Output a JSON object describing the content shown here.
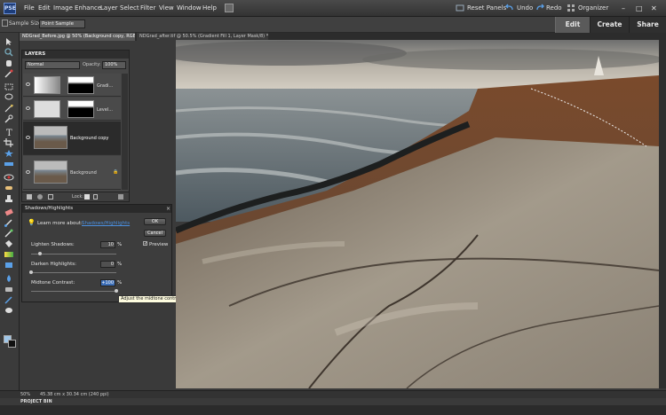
{
  "app": {
    "logo_text": "PSE",
    "menu": [
      "File",
      "Edit",
      "Image",
      "Enhance",
      "Layer",
      "Select",
      "Filter",
      "View",
      "Window",
      "Help"
    ],
    "reset_panels": "Reset Panels",
    "undo": "Undo",
    "redo": "Redo",
    "organizer": "Organizer"
  },
  "modes": {
    "edit": "Edit",
    "create": "Create",
    "share": "Share",
    "active": "Edit"
  },
  "options_bar": {
    "sample_size_label": "Sample Size:",
    "sample_size_value": "Point Sample"
  },
  "doc_tabs": [
    {
      "label": "NDGrad_Before.jpg @ 50% (Background copy, RGB/8*) *"
    },
    {
      "label": "NDGrad_after.tif @ 50.5% (Gradient Fill 1, Layer Mask/8) *"
    }
  ],
  "layers_panel": {
    "title": "LAYERS",
    "blend_mode": "Normal",
    "opacity_label": "Opacity:",
    "opacity_value": "100%",
    "lock_label": "Lock:",
    "layers": [
      {
        "name": "Gradi...",
        "selected": false
      },
      {
        "name": "Level...",
        "selected": false
      },
      {
        "name": "Background copy",
        "selected": true
      },
      {
        "name": "Background",
        "selected": false
      }
    ]
  },
  "dialog": {
    "title": "Shadows/Highlights",
    "learn_more_prefix": "Learn more about:",
    "learn_more_link": "Shadows/Highlights",
    "ok": "OK",
    "cancel": "Cancel",
    "preview_label": "Preview",
    "preview_checked": true,
    "lighten_label": "Lighten Shadows:",
    "lighten_value": "10",
    "darken_label": "Darken Highlights:",
    "darken_value": "0",
    "midtone_label": "Midtone Contrast:",
    "midtone_value": "+100",
    "percent": "%",
    "lighten_level": 0.1,
    "darken_level": 0.0,
    "midtone_level": 1.0
  },
  "tooltip": "Adjust the midtone contrast",
  "status": {
    "zoom": "50%",
    "doc_size": "45.38 cm x 30.34 cm (240 ppi)",
    "project_bin": "PROJECT BIN"
  },
  "colors": {
    "accent_blue": "#4a90e2",
    "selected_layer": "#2b2b2b",
    "tooltip_bg": "#fffde0"
  }
}
